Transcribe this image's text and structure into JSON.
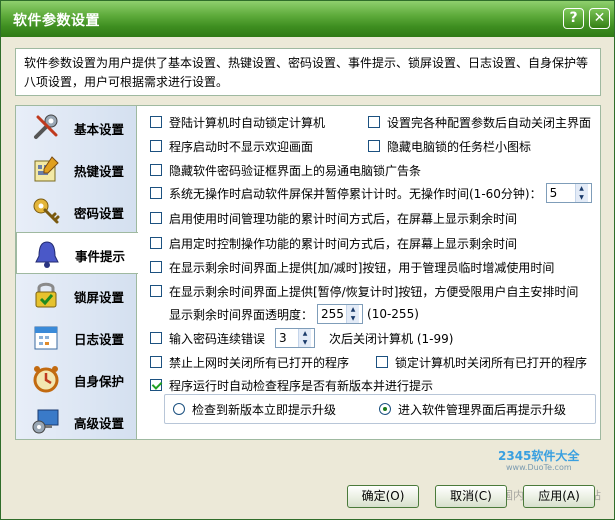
{
  "window": {
    "title": "软件参数设置"
  },
  "titlebar": {
    "help_glyph": "?",
    "close_glyph": "✕"
  },
  "description": "软件参数设置为用户提供了基本设置、热键设置、密码设置、事件提示、锁屏设置、日志设置、自身保护等八项设置，用户可根据需求进行设置。",
  "nav": {
    "items": [
      {
        "label": "基本设置",
        "icon": "tools-icon",
        "active": false
      },
      {
        "label": "热键设置",
        "icon": "keyboard-edit-icon",
        "active": false
      },
      {
        "label": "密码设置",
        "icon": "key-icon",
        "active": false
      },
      {
        "label": "事件提示",
        "icon": "bell-icon",
        "active": true
      },
      {
        "label": "锁屏设置",
        "icon": "lock-icon",
        "active": false
      },
      {
        "label": "日志设置",
        "icon": "calendar-icon",
        "active": false
      },
      {
        "label": "自身保护",
        "icon": "clock-alarm-icon",
        "active": false
      },
      {
        "label": "高级设置",
        "icon": "monitor-gear-icon",
        "active": false
      }
    ]
  },
  "options": {
    "auto_lock_on_login": {
      "label": "登陆计算机时自动锁定计算机",
      "checked": false
    },
    "close_main_after_config": {
      "label": "设置完各种配置参数后自动关闭主界面",
      "checked": false
    },
    "hide_welcome": {
      "label": "程序启动时不显示欢迎画面",
      "checked": false
    },
    "hide_tray_icon": {
      "label": "隐藏电脑锁的任务栏小图标",
      "checked": false
    },
    "hide_ad": {
      "label": "隐藏软件密码验证框界面上的易通电脑锁广告条",
      "checked": false
    },
    "idle_screensaver": {
      "label": "系统无操作时启动软件屏保并暂停累计计时。无操作时间(1-60分钟)：",
      "checked": false,
      "value": "5"
    },
    "show_remaining_cumulative": {
      "label": "启用使用时间管理功能的累计时间方式后，在屏幕上显示剩余时间",
      "checked": false
    },
    "show_remaining_timer": {
      "label": "启用定时控制操作功能的累计时间方式后，在屏幕上显示剩余时间",
      "checked": false
    },
    "add_reduce_button": {
      "label": "在显示剩余时间界面上提供[加/减时]按钮，用于管理员临时增减使用时间",
      "checked": false
    },
    "pause_resume_button": {
      "label": "在显示剩余时间界面上提供[暂停/恢复计时]按钮，方便受限用户自主安排时间",
      "checked": false
    },
    "transparency": {
      "label": "显示剩余时间界面透明度：",
      "value": "255",
      "range": "(10-255)"
    },
    "password_errors": {
      "label": "输入密码连续错误",
      "value": "3",
      "suffix": "次后关闭计算机 (1-99)",
      "checked": false
    },
    "close_on_internet_ban": {
      "label": "禁止上网时关闭所有已打开的程序",
      "checked": false
    },
    "close_on_lock": {
      "label": "锁定计算机时关闭所有已打开的程序",
      "checked": false
    },
    "auto_check_update": {
      "label": "程序运行时自动检查程序是否有新版本并进行提示",
      "checked": true
    }
  },
  "update_mode": {
    "options": [
      {
        "label": "检查到新版本立即提示升级",
        "selected": false
      },
      {
        "label": "进入软件管理界面后再提示升级",
        "selected": true
      }
    ]
  },
  "watermark": {
    "brand": "2345软件大全",
    "url": "www.DuoTe.com",
    "caption": "国内最安全的软件站"
  },
  "footer": {
    "ok_label": "确定(O)",
    "cancel_label": "取消(C)",
    "apply_label": "应用(A)"
  },
  "colors": {
    "title_bar": "#3f8f21",
    "panel_border": "#9fb9a0",
    "dialog_bg": "#ece9d8",
    "check_mark": "#21a121"
  }
}
